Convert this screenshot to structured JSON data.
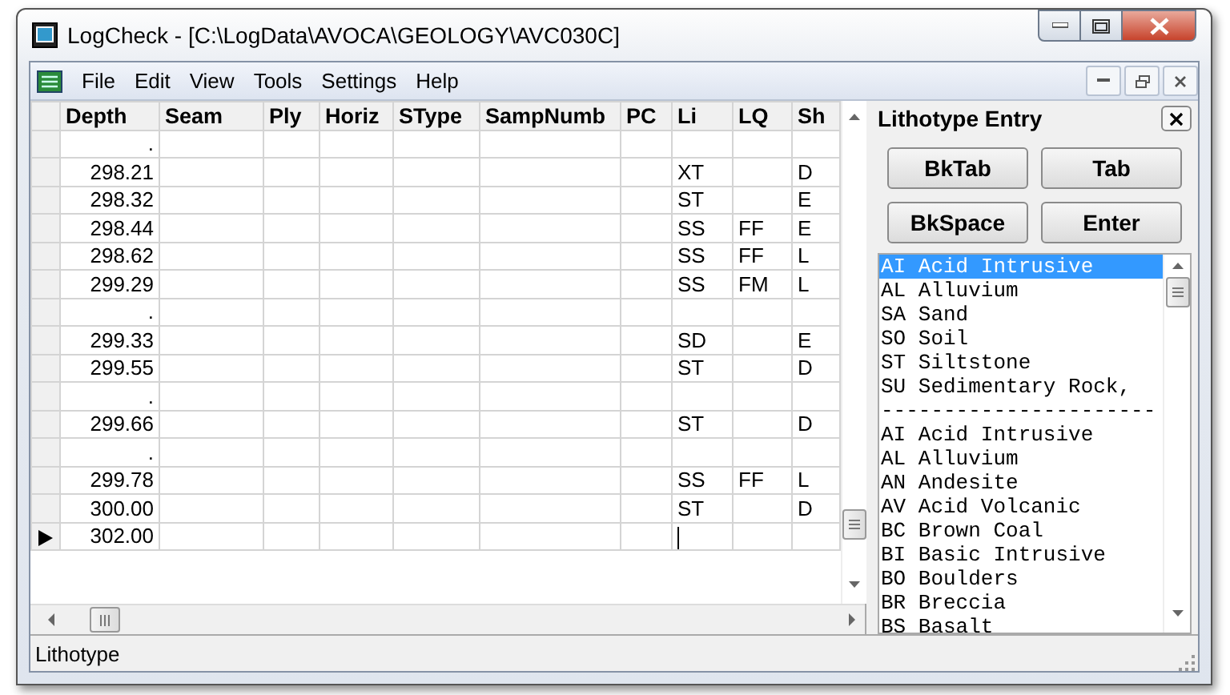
{
  "window": {
    "title": "LogCheck - [C:\\LogData\\AVOCA\\GEOLOGY\\AVC030C]"
  },
  "menu": [
    "File",
    "Edit",
    "View",
    "Tools",
    "Settings",
    "Help"
  ],
  "table": {
    "columns": [
      "Depth",
      "Seam",
      "Ply",
      "Horiz",
      "SType",
      "SampNumb",
      "PC",
      "Li",
      "LQ",
      "Sh"
    ],
    "rows": [
      {
        "depth": ".",
        "selected": false
      },
      {
        "depth": "298.21",
        "li": "XT",
        "sh": "D",
        "selected": false
      },
      {
        "depth": "298.32",
        "li": "ST",
        "sh": "E",
        "selected": false
      },
      {
        "depth": "298.44",
        "li": "SS",
        "lq": "FF",
        "sh": "E",
        "selected": false
      },
      {
        "depth": "298.62",
        "li": "SS",
        "lq": "FF",
        "sh": "L",
        "selected": false
      },
      {
        "depth": "299.29",
        "li": "SS",
        "lq": "FM",
        "sh": "L",
        "selected": false
      },
      {
        "depth": ".",
        "selected": false
      },
      {
        "depth": "299.33",
        "li": "SD",
        "sh": "E",
        "selected": false
      },
      {
        "depth": "299.55",
        "li": "ST",
        "sh": "D",
        "selected": false
      },
      {
        "depth": ".",
        "selected": false
      },
      {
        "depth": "299.66",
        "li": "ST",
        "sh": "D",
        "selected": false
      },
      {
        "depth": ".",
        "selected": false
      },
      {
        "depth": "299.78",
        "li": "SS",
        "lq": "FF",
        "sh": "L",
        "selected": false
      },
      {
        "depth": "300.00",
        "li": "ST",
        "sh": "D",
        "selected": false
      },
      {
        "depth": "302.00",
        "selected": true
      }
    ]
  },
  "panel": {
    "title": "Lithotype Entry",
    "buttons": [
      "BkTab",
      "Tab",
      "BkSpace",
      "Enter"
    ],
    "items": [
      {
        "text": "AI Acid Intrusive",
        "selected": true
      },
      {
        "text": "AL Alluvium",
        "selected": false
      },
      {
        "text": "SA Sand",
        "selected": false
      },
      {
        "text": "SO Soil",
        "selected": false
      },
      {
        "text": "ST Siltstone",
        "selected": false
      },
      {
        "text": "SU Sedimentary Rock,",
        "selected": false
      },
      {
        "text": "----------------------",
        "selected": false
      },
      {
        "text": "AI Acid Intrusive",
        "selected": false
      },
      {
        "text": "AL Alluvium",
        "selected": false
      },
      {
        "text": "AN Andesite",
        "selected": false
      },
      {
        "text": "AV Acid Volcanic",
        "selected": false
      },
      {
        "text": "BC Brown Coal",
        "selected": false
      },
      {
        "text": "BI Basic Intrusive",
        "selected": false
      },
      {
        "text": "BO Boulders",
        "selected": false
      },
      {
        "text": "BR Breccia",
        "selected": false
      },
      {
        "text": "BS Basalt",
        "selected": false
      }
    ]
  },
  "status_bar": {
    "text": "Lithotype"
  }
}
